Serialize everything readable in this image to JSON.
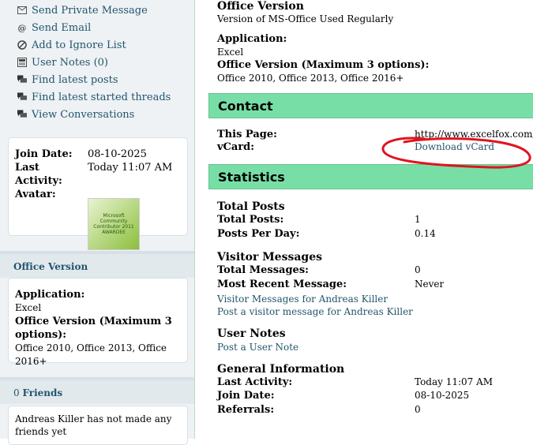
{
  "sidebar": {
    "actions": [
      {
        "icon": "envelope-icon",
        "label": "Send Private Message"
      },
      {
        "icon": "at-sign-icon",
        "label": "Send Email"
      },
      {
        "icon": "ignore-icon",
        "label": "Add to Ignore List"
      },
      {
        "icon": "notes-icon",
        "label": "User Notes (0)"
      },
      {
        "icon": "posts-icon",
        "label": "Find latest posts"
      },
      {
        "icon": "threads-icon",
        "label": "Find latest started threads"
      },
      {
        "icon": "conversations-icon",
        "label": "View Conversations"
      }
    ],
    "info": {
      "join_date_label": "Join Date:",
      "join_date": "08-10-2025",
      "last_activity_label": "Last Activity:",
      "last_activity": "Today 11:07 AM",
      "avatar_label": "Avatar:",
      "avatar_text": "Microsoft Community Contributor 2011 AWARDEE"
    },
    "office_version": {
      "title": "Office Version",
      "application_label": "Application:",
      "application": "Excel",
      "version_label": "Office Version (Maximum 3 options):",
      "version": "Office 2010, Office 2013, Office 2016+"
    },
    "friends": {
      "count": "0",
      "title": "Friends",
      "text": "Andreas Killer has not made any friends yet"
    }
  },
  "main": {
    "office": {
      "title": "Office Version",
      "subtitle": "Version of MS-Office Used Regularly",
      "application_label": "Application:",
      "application": "Excel",
      "version_label": "Office Version (Maximum 3 options):",
      "version": "Office 2010, Office 2013, Office 2016+"
    },
    "contact": {
      "title": "Contact",
      "this_page_label": "This Page:",
      "this_page": "http://www.excelfox.com/forum/member.php?u=",
      "vcard_label": "vCard:",
      "vcard_link": "Download vCard"
    },
    "statistics": {
      "title": "Statistics",
      "total_posts_title": "Total Posts",
      "total_posts_label": "Total Posts:",
      "total_posts": "1",
      "posts_per_day_label": "Posts Per Day:",
      "posts_per_day": "0.14",
      "visitor_title": "Visitor Messages",
      "total_messages_label": "Total Messages:",
      "total_messages": "0",
      "recent_label": "Most Recent Message:",
      "recent": "Never",
      "visitor_link1": "Visitor Messages for Andreas Killer",
      "visitor_link2": "Post a visitor message for Andreas Killer",
      "notes_title": "User Notes",
      "notes_link": "Post a User Note",
      "general_title": "General Information",
      "gen_last_label": "Last Activity:",
      "gen_last": "Today 11:07 AM",
      "gen_join_label": "Join Date:",
      "gen_join": "08-10-2025",
      "referrals_label": "Referrals:",
      "referrals": "0"
    }
  },
  "colors": {
    "section_bar": "#77dfa6",
    "link": "#22556b",
    "annotation": "#e0141e"
  }
}
